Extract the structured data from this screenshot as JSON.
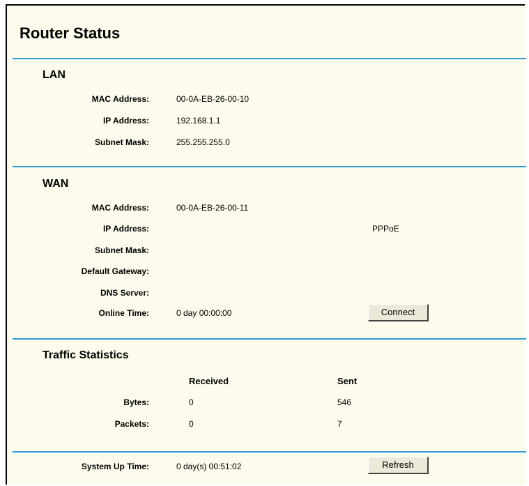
{
  "page_title": "Router Status",
  "lan": {
    "title": "LAN",
    "mac_label": "MAC Address:",
    "mac": "00-0A-EB-26-00-10",
    "ip_label": "IP Address:",
    "ip": "192.168.1.1",
    "subnet_label": "Subnet Mask:",
    "subnet": "255.255.255.0"
  },
  "wan": {
    "title": "WAN",
    "mac_label": "MAC Address:",
    "mac": "00-0A-EB-26-00-11",
    "ip_label": "IP Address:",
    "ip": "",
    "connection_type": "PPPoE",
    "subnet_label": "Subnet Mask:",
    "subnet": "",
    "gateway_label": "Default Gateway:",
    "gateway": "",
    "dns_label": "DNS Server:",
    "dns": "",
    "online_label": "Online Time:",
    "online_time": "0 day 00:00:00",
    "connect_button": "Connect"
  },
  "traffic": {
    "title": "Traffic Statistics",
    "received_header": "Received",
    "sent_header": "Sent",
    "bytes_label": "Bytes:",
    "bytes_received": "0",
    "bytes_sent": "546",
    "packets_label": "Packets:",
    "packets_received": "0",
    "packets_sent": "7"
  },
  "system": {
    "uptime_label": "System Up Time:",
    "uptime": "0 day(s) 00:51:02",
    "refresh_button": "Refresh"
  },
  "colors": {
    "background": "#fdfbeb",
    "separator": "#2d9ad7"
  }
}
